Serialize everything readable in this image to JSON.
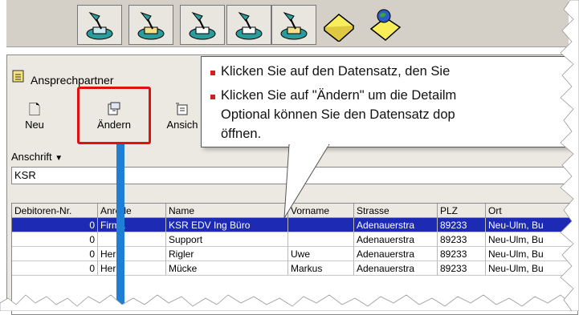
{
  "toolbar_top": {
    "buttons": [
      {
        "name": "lamp-doc-icon"
      },
      {
        "name": "lamp-doc-icon"
      },
      {
        "name": "lamp-doc-icon"
      },
      {
        "name": "lamp-doc-icon"
      },
      {
        "name": "lamp-doc-icon"
      },
      {
        "name": "folder-yellow-icon"
      },
      {
        "name": "globe-folder-icon"
      }
    ]
  },
  "window": {
    "title": "Ansprechpartner",
    "buttons": [
      {
        "label": "Neu"
      },
      {
        "label": "Ändern"
      },
      {
        "label": "Ansich"
      }
    ],
    "filter_label": "Anschrift",
    "filter_value": "KSR"
  },
  "grid": {
    "headers": [
      "Debitoren-Nr.",
      "Anrede",
      "Name",
      "Vorname",
      "Strasse",
      "PLZ",
      "Ort"
    ],
    "rows": [
      {
        "nr": "0",
        "anrede": "Firma",
        "name": "KSR EDV Ing Büro",
        "vorname": "",
        "strasse": "Adenauerstra",
        "plz": "89233",
        "ort": "Neu-Ulm, Bu"
      },
      {
        "nr": "0",
        "anrede": "",
        "name": "Support",
        "vorname": "",
        "strasse": "Adenauerstra",
        "plz": "89233",
        "ort": "Neu-Ulm, Bu"
      },
      {
        "nr": "0",
        "anrede": "Herr",
        "name": "Rigler",
        "vorname": "Uwe",
        "strasse": "Adenauerstra",
        "plz": "89233",
        "ort": "Neu-Ulm, Bu"
      },
      {
        "nr": "0",
        "anrede": "Herr",
        "name": "Mücke",
        "vorname": "Markus",
        "strasse": "Adenauerstra",
        "plz": "89233",
        "ort": "Neu-Ulm, Bu"
      }
    ]
  },
  "callout": {
    "line1": "Klicken Sie auf den Datensatz, den Sie",
    "line2": "Klicken Sie auf \"Ändern\" um die Detailm",
    "line3": "Optional können Sie den Datensatz dop",
    "line4": "öffnen."
  },
  "colors": {
    "selection": "#1d2bb4",
    "highlight": "#e01010",
    "bullet": "#d02020",
    "arrow": "#1f7fd4"
  }
}
